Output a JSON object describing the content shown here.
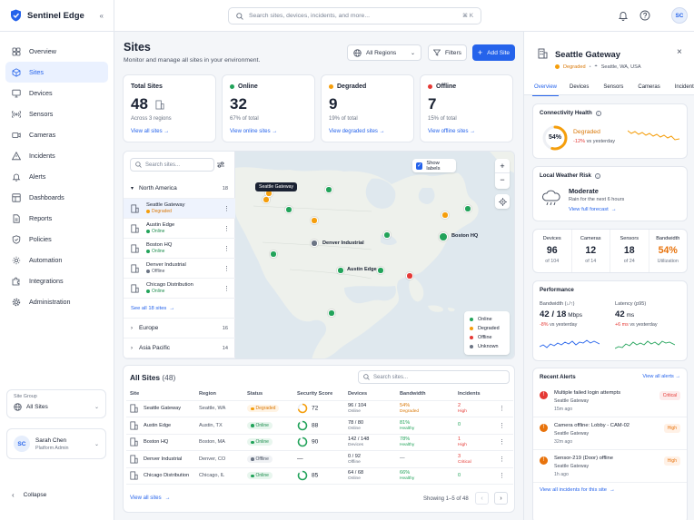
{
  "app": {
    "name": "Sentinel Edge"
  },
  "nav": [
    {
      "label": "Overview",
      "icon": "grid-icon"
    },
    {
      "label": "Sites",
      "icon": "cube-icon",
      "active": true
    },
    {
      "label": "Devices",
      "icon": "monitor-icon"
    },
    {
      "label": "Sensors",
      "icon": "signal-icon"
    },
    {
      "label": "Cameras",
      "icon": "camera-icon"
    },
    {
      "label": "Incidents",
      "icon": "alert-triangle-icon"
    },
    {
      "label": "Alerts",
      "icon": "bell-icon"
    },
    {
      "label": "Dashboards",
      "icon": "dashboard-icon"
    },
    {
      "label": "Reports",
      "icon": "file-icon"
    },
    {
      "label": "Policies",
      "icon": "shield-icon"
    },
    {
      "label": "Automation",
      "icon": "automation-icon"
    },
    {
      "label": "Integrations",
      "icon": "puzzle-icon"
    },
    {
      "label": "Administration",
      "icon": "gear-icon"
    }
  ],
  "site_group": {
    "label": "Site Group",
    "value": "All Sites"
  },
  "user": {
    "initials": "SC",
    "name": "Sarah Chen",
    "role": "Platform Admin"
  },
  "collapse_label": "Collapse",
  "search": {
    "placeholder": "Search sites, devices, incidents, and more...",
    "shortcut": "⌘ K"
  },
  "topbar": {
    "avatar": "SC"
  },
  "page": {
    "title": "Sites",
    "subtitle": "Monitor and manage all sites in your environment.",
    "region": "All Regions",
    "filters": "Filters",
    "add": "Add Site"
  },
  "stats": [
    {
      "title": "Total Sites",
      "value": "48",
      "sub": "Across 3 regions",
      "link": "View all sites",
      "color": ""
    },
    {
      "title": "Online",
      "value": "32",
      "sub": "67% of total",
      "link": "View online sites",
      "color": "#22a35a"
    },
    {
      "title": "Degraded",
      "value": "9",
      "sub": "19% of total",
      "link": "View degraded sites",
      "color": "#f59e0b"
    },
    {
      "title": "Offline",
      "value": "7",
      "sub": "15% of total",
      "link": "View offline sites",
      "color": "#e53935"
    }
  ],
  "sitelist": {
    "placeholder": "Search sites...",
    "groups": [
      {
        "name": "North America",
        "count": "18"
      },
      {
        "name": "Europe",
        "count": "16"
      },
      {
        "name": "Asia Pacific",
        "count": "14"
      }
    ],
    "sites": [
      {
        "name": "Seattle Gateway",
        "status": "Degraded",
        "color": "#f59e0b"
      },
      {
        "name": "Austin Edge",
        "status": "Online",
        "color": "#22a35a"
      },
      {
        "name": "Boston HQ",
        "status": "Online",
        "color": "#22a35a"
      },
      {
        "name": "Denver Industrial",
        "status": "Offline",
        "color": "#6b7484"
      },
      {
        "name": "Chicago Distribution",
        "status": "Online",
        "color": "#22a35a"
      }
    ],
    "see_all": "See all 18 sites"
  },
  "map": {
    "show_labels": "Show labels",
    "labels": [
      "Seattle Gateway",
      "Denver Industrial",
      "Boston HQ",
      "Austin Edge"
    ],
    "legend": [
      {
        "label": "Online",
        "color": "#22a35a"
      },
      {
        "label": "Degraded",
        "color": "#f59e0b"
      },
      {
        "label": "Offline",
        "color": "#e53935"
      },
      {
        "label": "Unknown",
        "color": "#6b7484"
      }
    ]
  },
  "table": {
    "title": "All Sites",
    "count": "(48)",
    "placeholder": "Search sites...",
    "headers": [
      "Site",
      "Region",
      "Status",
      "Security Score",
      "Devices",
      "Bandwidth",
      "Incidents"
    ],
    "rows": [
      {
        "site": "Seattle Gateway",
        "region": "Seattle, WA",
        "status": "Degraded",
        "score": "72",
        "score_pct": 0.72,
        "score_color": "#f59e0b",
        "devices": "96 / 104",
        "devices_sub": "Online",
        "bw": "54%",
        "bw_sub": "Degraded",
        "bw_color": "#d97706",
        "inc": "2",
        "inc_sub": "High",
        "inc_color": "#e53935"
      },
      {
        "site": "Austin Edge",
        "region": "Austin, TX",
        "status": "Online",
        "score": "88",
        "score_pct": 0.88,
        "score_color": "#22a35a",
        "devices": "78 / 80",
        "devices_sub": "Online",
        "bw": "81%",
        "bw_sub": "Healthy",
        "bw_color": "#22a35a",
        "inc": "0",
        "inc_sub": "",
        "inc_color": "#22a35a"
      },
      {
        "site": "Boston HQ",
        "region": "Boston, MA",
        "status": "Online",
        "score": "90",
        "score_pct": 0.9,
        "score_color": "#22a35a",
        "devices": "142 / 148",
        "devices_sub": "Devices",
        "bw": "78%",
        "bw_sub": "Healthy",
        "bw_color": "#22a35a",
        "inc": "1",
        "inc_sub": "High",
        "inc_color": "#e53935"
      },
      {
        "site": "Denver Industrial",
        "region": "Denver, CO",
        "status": "Offline",
        "score": "—",
        "score_pct": 0,
        "score_color": "#9aa1ad",
        "devices": "0 / 92",
        "devices_sub": "Offline",
        "bw": "—",
        "bw_sub": "",
        "bw_color": "#4a5262",
        "inc": "3",
        "inc_sub": "Critical",
        "inc_color": "#e53935"
      },
      {
        "site": "Chicago Distribution",
        "region": "Chicago, IL",
        "status": "Online",
        "score": "85",
        "score_pct": 0.85,
        "score_color": "#22a35a",
        "devices": "64 / 68",
        "devices_sub": "Online",
        "bw": "66%",
        "bw_sub": "Healthy",
        "bw_color": "#22a35a",
        "inc": "0",
        "inc_sub": "",
        "inc_color": "#22a35a"
      }
    ],
    "view_all": "View all sites",
    "showing": "Showing 1–5 of 48"
  },
  "panel": {
    "title": "Seattle Gateway",
    "status": "Degraded",
    "location": "Seattle, WA, USA",
    "tabs": [
      "Overview",
      "Devices",
      "Sensors",
      "Cameras",
      "Incidents"
    ],
    "health": {
      "title": "Connectivity Health",
      "pct": "54%",
      "pct_value": 0.54,
      "status": "Degraded",
      "change": "-12%",
      "change_sub": "vs yesterday"
    },
    "weather": {
      "title": "Local Weather Risk",
      "level": "Moderate",
      "desc": "Rain for the next 6 hours",
      "link": "View full forecast"
    },
    "metrics": [
      {
        "label": "Devices",
        "value": "96",
        "sub": "of 104"
      },
      {
        "label": "Cameras",
        "value": "12",
        "sub": "of 14"
      },
      {
        "label": "Sensors",
        "value": "18",
        "sub": "of 24"
      },
      {
        "label": "Bandwidth",
        "value": "54%",
        "sub": "Utilization"
      }
    ],
    "performance": {
      "title": "Performance",
      "bw_label": "Bandwidth (↓/↑)",
      "bw_value": "42 / 18",
      "bw_unit": "Mbps",
      "bw_change": "-8%",
      "lat_label": "Latency (p95)",
      "lat_value": "42",
      "lat_unit": "ms",
      "lat_change": "+6 ms",
      "vs": "vs yesterday"
    },
    "alerts": {
      "title": "Recent Alerts",
      "view_all": "View all alerts",
      "items": [
        {
          "title": "Multiple failed login attempts",
          "sub": "Seattle Gateway",
          "time": "15m ago",
          "sev": "Critical",
          "color": "#e53935",
          "bg": "#fdecec"
        },
        {
          "title": "Camera offline: Lobby - CAM-02",
          "sub": "Seattle Gateway",
          "time": "32m ago",
          "sev": "High",
          "color": "#e8730c",
          "bg": "#fff1e6"
        },
        {
          "title": "Sensor-219 (Door) offline",
          "sub": "Seattle Gateway",
          "time": "1h ago",
          "sev": "High",
          "color": "#e8730c",
          "bg": "#fff1e6"
        }
      ],
      "footer": "View all incidents for this site"
    }
  }
}
